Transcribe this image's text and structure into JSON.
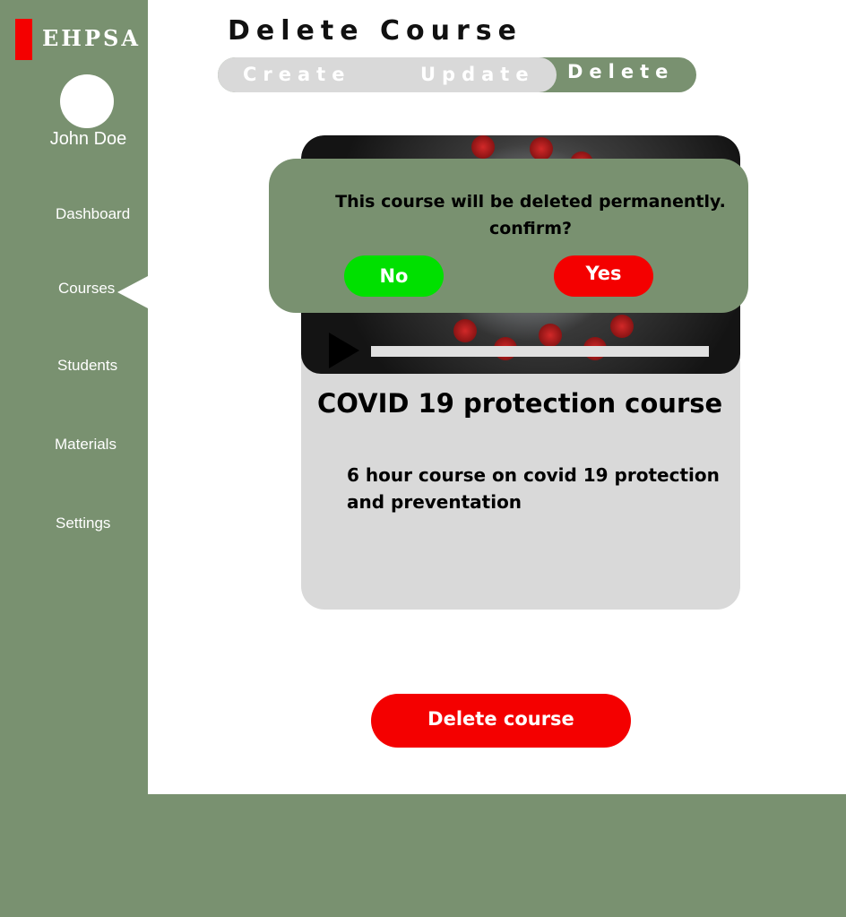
{
  "app": {
    "logo_text": "EHPSA",
    "brand_color": "#799170",
    "accent_color": "#f40000"
  },
  "user": {
    "name": "John Doe"
  },
  "sidebar": {
    "items": [
      {
        "label": "Dashboard"
      },
      {
        "label": "Courses",
        "active": true
      },
      {
        "label": "Students"
      },
      {
        "label": "Materials"
      },
      {
        "label": "Settings"
      }
    ]
  },
  "page": {
    "title": "Delete Course"
  },
  "tabs": [
    {
      "label": "Create"
    },
    {
      "label": "Update"
    },
    {
      "label": "Delete",
      "active": true
    }
  ],
  "course": {
    "title": "COVID 19 protection course",
    "description": "6 hour course on covid 19 protection and preventation",
    "video": {
      "progress": 0
    }
  },
  "dialog": {
    "message": "This course will be deleted permanently. confirm?",
    "no_label": "No",
    "yes_label": "Yes",
    "no_color": "#00e000",
    "yes_color": "#f40000"
  },
  "actions": {
    "delete_label": "Delete course"
  }
}
